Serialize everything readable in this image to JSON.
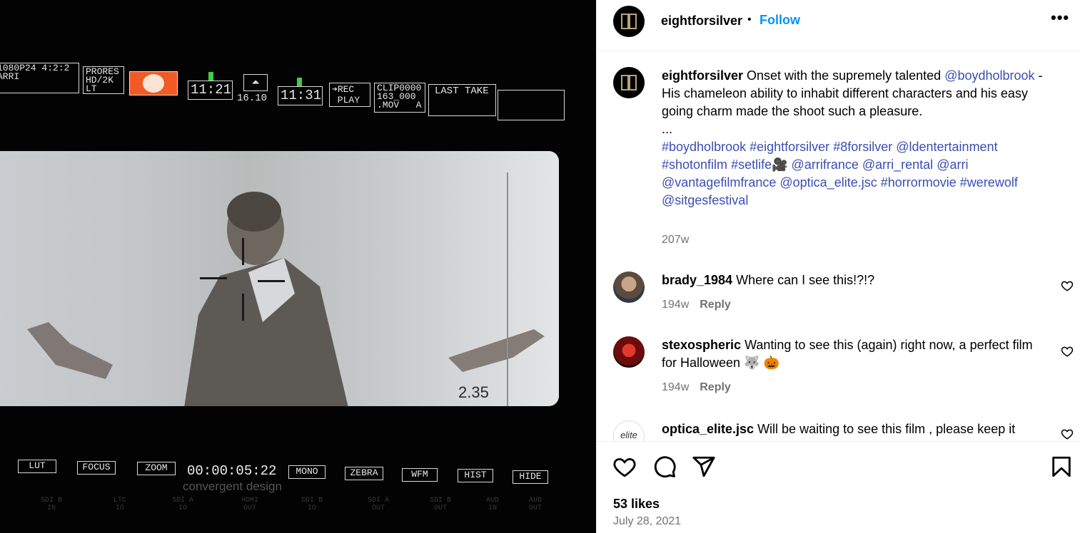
{
  "media": {
    "hud_top": {
      "format": "1080P24 4:2:2\nARRI",
      "codec": "PRORES\nHD/2K\nLT",
      "time_a": "11:21",
      "time_b": "11:31",
      "shutter": "16.10",
      "rec": "➔REC\n PLAY",
      "clip": "CLIP0000\n163_000\n.MOV   A",
      "last_take": "LAST TAKE"
    },
    "ratio": "2.35",
    "timecode": "00:00:05:22",
    "bottom_buttons": [
      "LUT",
      "FOCUS",
      "ZOOM",
      "MONO",
      "ZEBRA",
      "WFM",
      "HIST",
      "HIDE"
    ],
    "brand": "convergent design",
    "faint_labels": [
      "SDI B\nIN",
      "LTC\nIO",
      "SDI A\nIO",
      "HDMI\nOUT",
      "SDI B\nIO",
      "SDI A\nOUT",
      "SDI B\nOUT",
      "AUD\nIN",
      "AUD\nOUT"
    ],
    "colors": {
      "rec_orange": "#f15a24",
      "tally_green": "#3fcf3f"
    }
  },
  "header": {
    "username": "eightforsilver",
    "separator": "•",
    "follow_label": "Follow",
    "more_label": "•••"
  },
  "caption": {
    "username": "eightforsilver",
    "text_1": " Onset with the supremely talented ",
    "mention_1": "@boydholbrook",
    "text_2": " - His chameleon ability to inhabit different characters and his easy going charm made the shoot such a pleasure.",
    "ellipsis": "...",
    "tags_line_1": [
      "#boydholbrook",
      "#eightforsilver",
      "#8forsilver",
      "@ldentertainment"
    ],
    "tags_line_2": [
      "#shotonfilm",
      "#setlife🎥",
      "@arrifrance",
      "@arri_rental",
      "@arri"
    ],
    "tags_line_3": [
      "@vantagefilmfrance",
      "@optica_elite.jsc",
      "#horrormovie",
      "#werewolf"
    ],
    "tags_line_4": [
      "@sitgesfestival"
    ],
    "age": "207w"
  },
  "comments": [
    {
      "username": "brady_1984",
      "text": " Where can I see this!?!?",
      "age": "194w",
      "reply_label": "Reply"
    },
    {
      "username": "stexospheric",
      "text": " Wanting to see this (again) right now, a perfect film for Halloween 🐺 🎃",
      "age": "194w",
      "reply_label": "Reply"
    },
    {
      "username": "optica_elite.jsc",
      "text": " Will be waiting to see this film , please keep it",
      "avatar_text": "elite"
    }
  ],
  "footer": {
    "likes": "53 likes",
    "date": "July 28, 2021"
  },
  "icons": [
    "heart-icon",
    "comment-icon",
    "share-icon",
    "bookmark-icon",
    "more-icon"
  ],
  "accent_colors": {
    "follow_blue": "#0095f6",
    "mention_blue": "#3a4fb3",
    "muted_gray": "#737373"
  }
}
